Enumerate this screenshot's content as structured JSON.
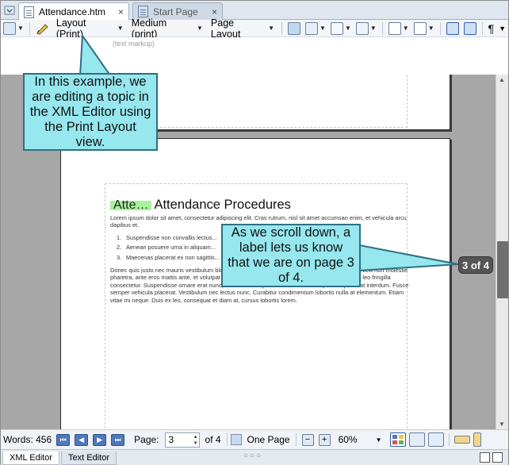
{
  "tabs": [
    {
      "label": "Attendance.htm",
      "close": "×",
      "active": true
    },
    {
      "label": "Start Page",
      "close": "×",
      "active": false
    }
  ],
  "toolbar": {
    "layout_dropdown": "Layout (Print)",
    "medium_dropdown": "Medium (print)",
    "page_layout_dropdown": "Page Layout",
    "pilcrow": "¶",
    "sublabel": "(text markup)"
  },
  "document": {
    "heading_label": "Atte…",
    "heading_text": "Attendance Procedures",
    "intro": "Lorem ipsum dolor sit amet, consectetur adipiscing elit. Cras rutrum, nisl sit amet accumsan enim, et vehicula arcu dapibus et.",
    "list": [
      {
        "num": "1.",
        "text": "Suspendisse non convallis lectus..."
      },
      {
        "num": "2.",
        "text": "Aenean posuere urna in aliquam..."
      },
      {
        "num": "3.",
        "text": "Maecenas placerat ex non sagittis..."
      }
    ],
    "body": "Donec quis justo nec mauris vestibulum blandit. Aliquam erat volutpat. Sed nec maximus blandit, velit non molestie pharetra, ante eros mattis ante, et volutpat justo lectus at urna. Suspendisse nec a velit maximus leo fringilla consectetur. Suspendisse ornare erat nunc, et blandit erat porttitor ac. Fusce volutpat sed purus at interdum. Fusce semper vehicula placerat. Vestibulum nec lectus nunc. Curabitur condimentum lobortis nulla at elementum. Etiam vitae mi neque. Duis ex leo, consequat et diam at, cursus lobortis lorem."
  },
  "page_indicator": "3 of 4",
  "callouts": {
    "first": "In this example, we are editing a topic in the XML Editor using the Print Layout view.",
    "second": "As we scroll down, a label lets us know that we are on page 3 of 4."
  },
  "statusbar": {
    "words": "Words: 456",
    "page_label": "Page:",
    "page_value": "3",
    "page_total": "of 4",
    "one_page": "One Page",
    "zoom": "60%"
  },
  "editor_tabs": [
    "XML Editor",
    "Text Editor"
  ],
  "colors": {
    "callout_fill": "#96e7ee",
    "callout_border": "#2f6f83",
    "heading_highlight": "#a6f39a",
    "page_badge": "#555555"
  }
}
